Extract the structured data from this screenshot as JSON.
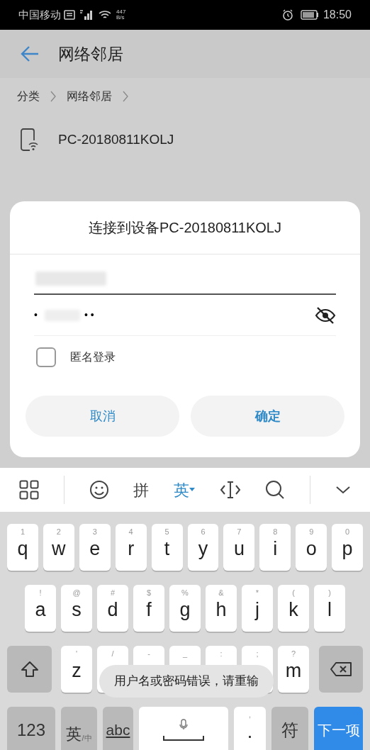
{
  "status_bar": {
    "carrier": "中国移动",
    "speed_value": "447",
    "speed_unit": "B/s",
    "time": "18:50"
  },
  "app_bar": {
    "title": "网络邻居"
  },
  "breadcrumb": [
    {
      "label": "分类"
    },
    {
      "label": "网络邻居"
    }
  ],
  "devices": [
    {
      "name": "PC-20180811KOLJ"
    }
  ],
  "dialog": {
    "title": "连接到设备PC-20180811KOLJ",
    "password_field": {
      "dots_start": "•",
      "dots_end": "••",
      "visible": false
    },
    "anonymous_login": {
      "label": "匿名登录",
      "checked": false
    },
    "buttons": [
      {
        "label": "取消",
        "kind": "cancel"
      },
      {
        "label": "确定",
        "kind": "confirm"
      }
    ]
  },
  "keyboard": {
    "toolbar": [
      {
        "kind": "grid"
      },
      {
        "kind": "emoji"
      },
      {
        "kind": "mode",
        "label": "拼",
        "selected": false
      },
      {
        "kind": "mode",
        "label": "英",
        "selected": true
      },
      {
        "kind": "cursor"
      },
      {
        "kind": "search"
      },
      {
        "kind": "collapse"
      }
    ],
    "rows": [
      {
        "keys": [
          {
            "kind": "letter",
            "hint": "1",
            "letter": "q"
          },
          {
            "kind": "letter",
            "hint": "2",
            "letter": "w"
          },
          {
            "kind": "letter",
            "hint": "3",
            "letter": "e"
          },
          {
            "kind": "letter",
            "hint": "4",
            "letter": "r"
          },
          {
            "kind": "letter",
            "hint": "5",
            "letter": "t"
          },
          {
            "kind": "letter",
            "hint": "6",
            "letter": "y"
          },
          {
            "kind": "letter",
            "hint": "7",
            "letter": "u"
          },
          {
            "kind": "letter",
            "hint": "8",
            "letter": "i"
          },
          {
            "kind": "letter",
            "hint": "9",
            "letter": "o"
          },
          {
            "kind": "letter",
            "hint": "0",
            "letter": "p"
          }
        ]
      },
      {
        "keys": [
          {
            "kind": "letter",
            "hint": "!",
            "letter": "a"
          },
          {
            "kind": "letter",
            "hint": "@",
            "letter": "s"
          },
          {
            "kind": "letter",
            "hint": "#",
            "letter": "d"
          },
          {
            "kind": "letter",
            "hint": "$",
            "letter": "f"
          },
          {
            "kind": "letter",
            "hint": "%",
            "letter": "g"
          },
          {
            "kind": "letter",
            "hint": "&",
            "letter": "h"
          },
          {
            "kind": "letter",
            "hint": "*",
            "letter": "j"
          },
          {
            "kind": "letter",
            "hint": "(",
            "letter": "k"
          },
          {
            "kind": "letter",
            "hint": ")",
            "letter": "l"
          }
        ]
      },
      {
        "keys": [
          {
            "kind": "shift"
          },
          {
            "kind": "letter",
            "hint": "'",
            "letter": "z"
          },
          {
            "kind": "letter",
            "hint": "/"
          },
          {
            "kind": "letter",
            "hint": "-"
          },
          {
            "kind": "letter",
            "hint": "_"
          },
          {
            "kind": "letter",
            "hint": ":"
          },
          {
            "kind": "letter",
            "hint": ";"
          },
          {
            "kind": "letter",
            "hint": "?",
            "letter": "m"
          },
          {
            "kind": "backspace"
          }
        ]
      },
      {
        "keys": [
          {
            "kind": "fn",
            "label": "123"
          },
          {
            "kind": "lang",
            "label": "英",
            "sub": "/中"
          },
          {
            "kind": "abc",
            "label": "abc"
          },
          {
            "kind": "space"
          },
          {
            "kind": "letter",
            "hint": ",",
            "letter": "."
          },
          {
            "kind": "fn",
            "label": "符"
          },
          {
            "kind": "enter",
            "label": "下一项"
          }
        ]
      }
    ],
    "toast": "用户名或密码错误，请重输"
  }
}
